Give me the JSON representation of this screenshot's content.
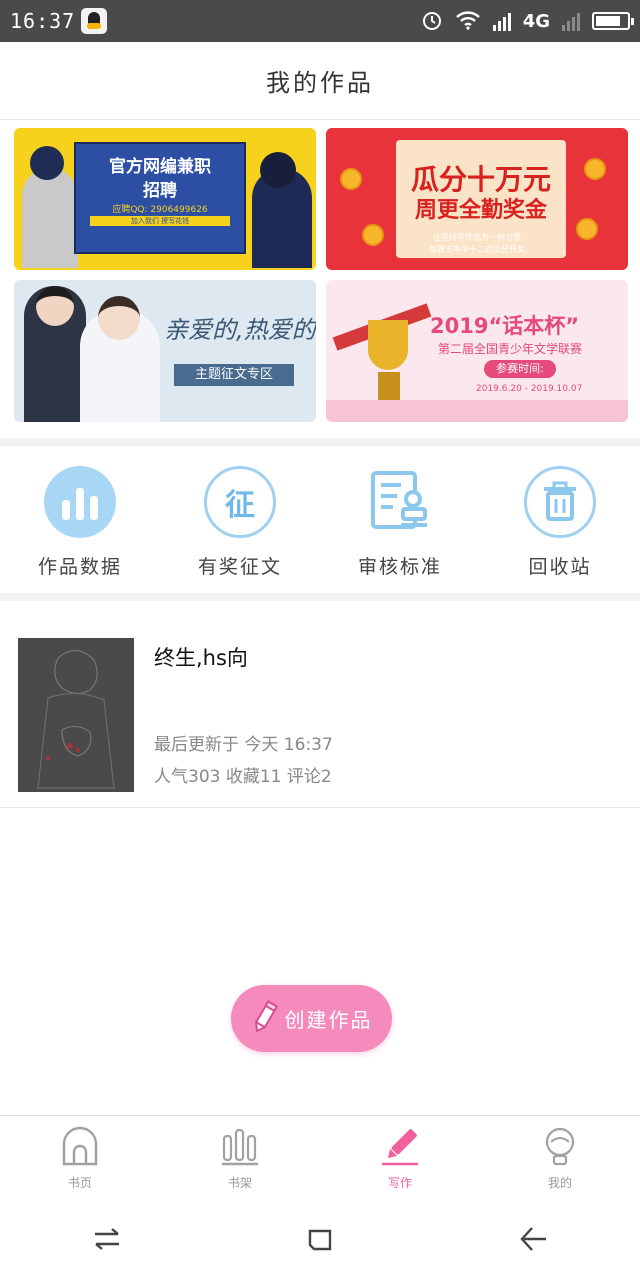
{
  "status_bar": {
    "time": "16:37",
    "network": "4G"
  },
  "header": {
    "title": "我的作品"
  },
  "banners": {
    "b1": {
      "line1": "官方网编兼职",
      "line2": "招聘",
      "contact": "应聘QQ: 2906499626",
      "sub": "加入我们  撩写花钱"
    },
    "b2": {
      "line1": "瓜分十万元",
      "line2": "周更全勤奖金",
      "sub1": "让坚持写作成为一种习惯",
      "sub2": "每周五中午十二点瓜分开奖"
    },
    "b3": {
      "line1": "亲爱的,热爱的",
      "tag": "主题征文专区"
    },
    "b4": {
      "line1": "2019“话本杯”",
      "line2": "第二届全国青少年文学联赛",
      "pill": "参赛时间:",
      "dates": "2019.6.20 - 2019.10.07"
    }
  },
  "quick_actions": [
    {
      "label": "作品数据",
      "icon": "bar-chart-icon"
    },
    {
      "label": "有奖征文",
      "icon": "contest-icon",
      "glyph": "征"
    },
    {
      "label": "审核标准",
      "icon": "review-doc-icon"
    },
    {
      "label": "回收站",
      "icon": "trash-icon"
    }
  ],
  "work": {
    "title": "终生,hs向",
    "updated": "最后更新于 今天 16:37",
    "stats": "人气303 收藏11 评论2"
  },
  "create_button": {
    "label": "创建作品"
  },
  "tabs": [
    {
      "label": "书页",
      "icon": "home-icon",
      "active": false
    },
    {
      "label": "书架",
      "icon": "bookshelf-icon",
      "active": false
    },
    {
      "label": "写作",
      "icon": "pencil-icon",
      "active": true
    },
    {
      "label": "我的",
      "icon": "profile-icon",
      "active": false
    }
  ],
  "colors": {
    "accent": "#f0609d",
    "icon_blue": "#9fd0f2",
    "create_btn": "#f58bbd"
  }
}
